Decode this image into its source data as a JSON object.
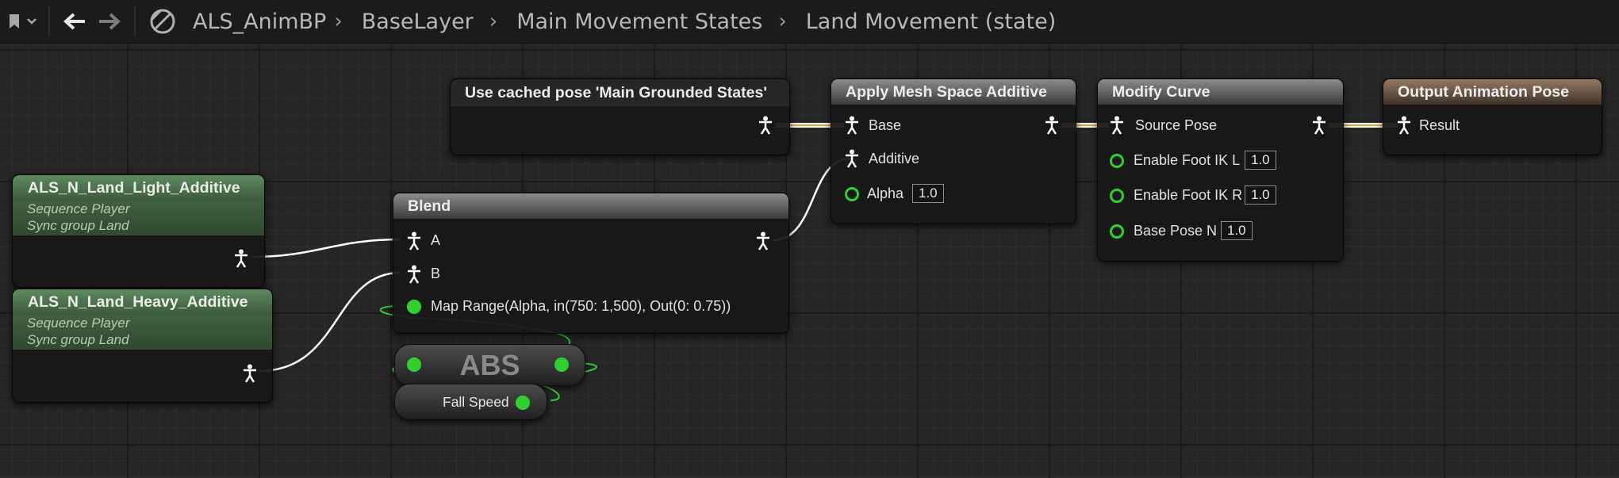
{
  "toolbar": {
    "breadcrumbs": [
      "ALS_AnimBP",
      "BaseLayer",
      "Main Movement States",
      "Land Movement (state)"
    ],
    "icons": [
      "bookmark-icon",
      "chevron-down-icon",
      "back-arrow-icon",
      "forward-arrow-icon",
      "blueprint-icon"
    ]
  },
  "nodes": {
    "cached_pose": {
      "title": "Use cached pose 'Main Grounded States'"
    },
    "apply_additive": {
      "title": "Apply Mesh Space Additive",
      "pins": {
        "base": "Base",
        "additive": "Additive",
        "alpha": "Alpha"
      },
      "alpha_value": "1.0"
    },
    "modify_curve": {
      "title": "Modify Curve",
      "source_pose": "Source Pose",
      "curves": [
        {
          "label": "Enable Foot IK L",
          "value": "1.0"
        },
        {
          "label": "Enable Foot IK R",
          "value": "1.0"
        },
        {
          "label": "Base Pose N",
          "value": "1.0"
        }
      ]
    },
    "output_pose": {
      "title": "Output Animation Pose",
      "pin": "Result"
    },
    "blend": {
      "title": "Blend",
      "pin_a": "A",
      "pin_b": "B",
      "alpha_expr": "Map Range(Alpha, in(750: 1,500), Out(0: 0.75))"
    },
    "seq_light": {
      "title": "ALS_N_Land_Light_Additive",
      "subtitle": "Sequence Player",
      "sync": "Sync group Land"
    },
    "seq_heavy": {
      "title": "ALS_N_Land_Heavy_Additive",
      "subtitle": "Sequence Player",
      "sync": "Sync group Land"
    },
    "abs": {
      "label": "ABS"
    },
    "fall_speed": {
      "label": "Fall Speed"
    }
  },
  "colors": {
    "pose_wire": "#ffffff",
    "float_wire": "#2fd12f",
    "pose_wire_accent": "#f0a530"
  }
}
